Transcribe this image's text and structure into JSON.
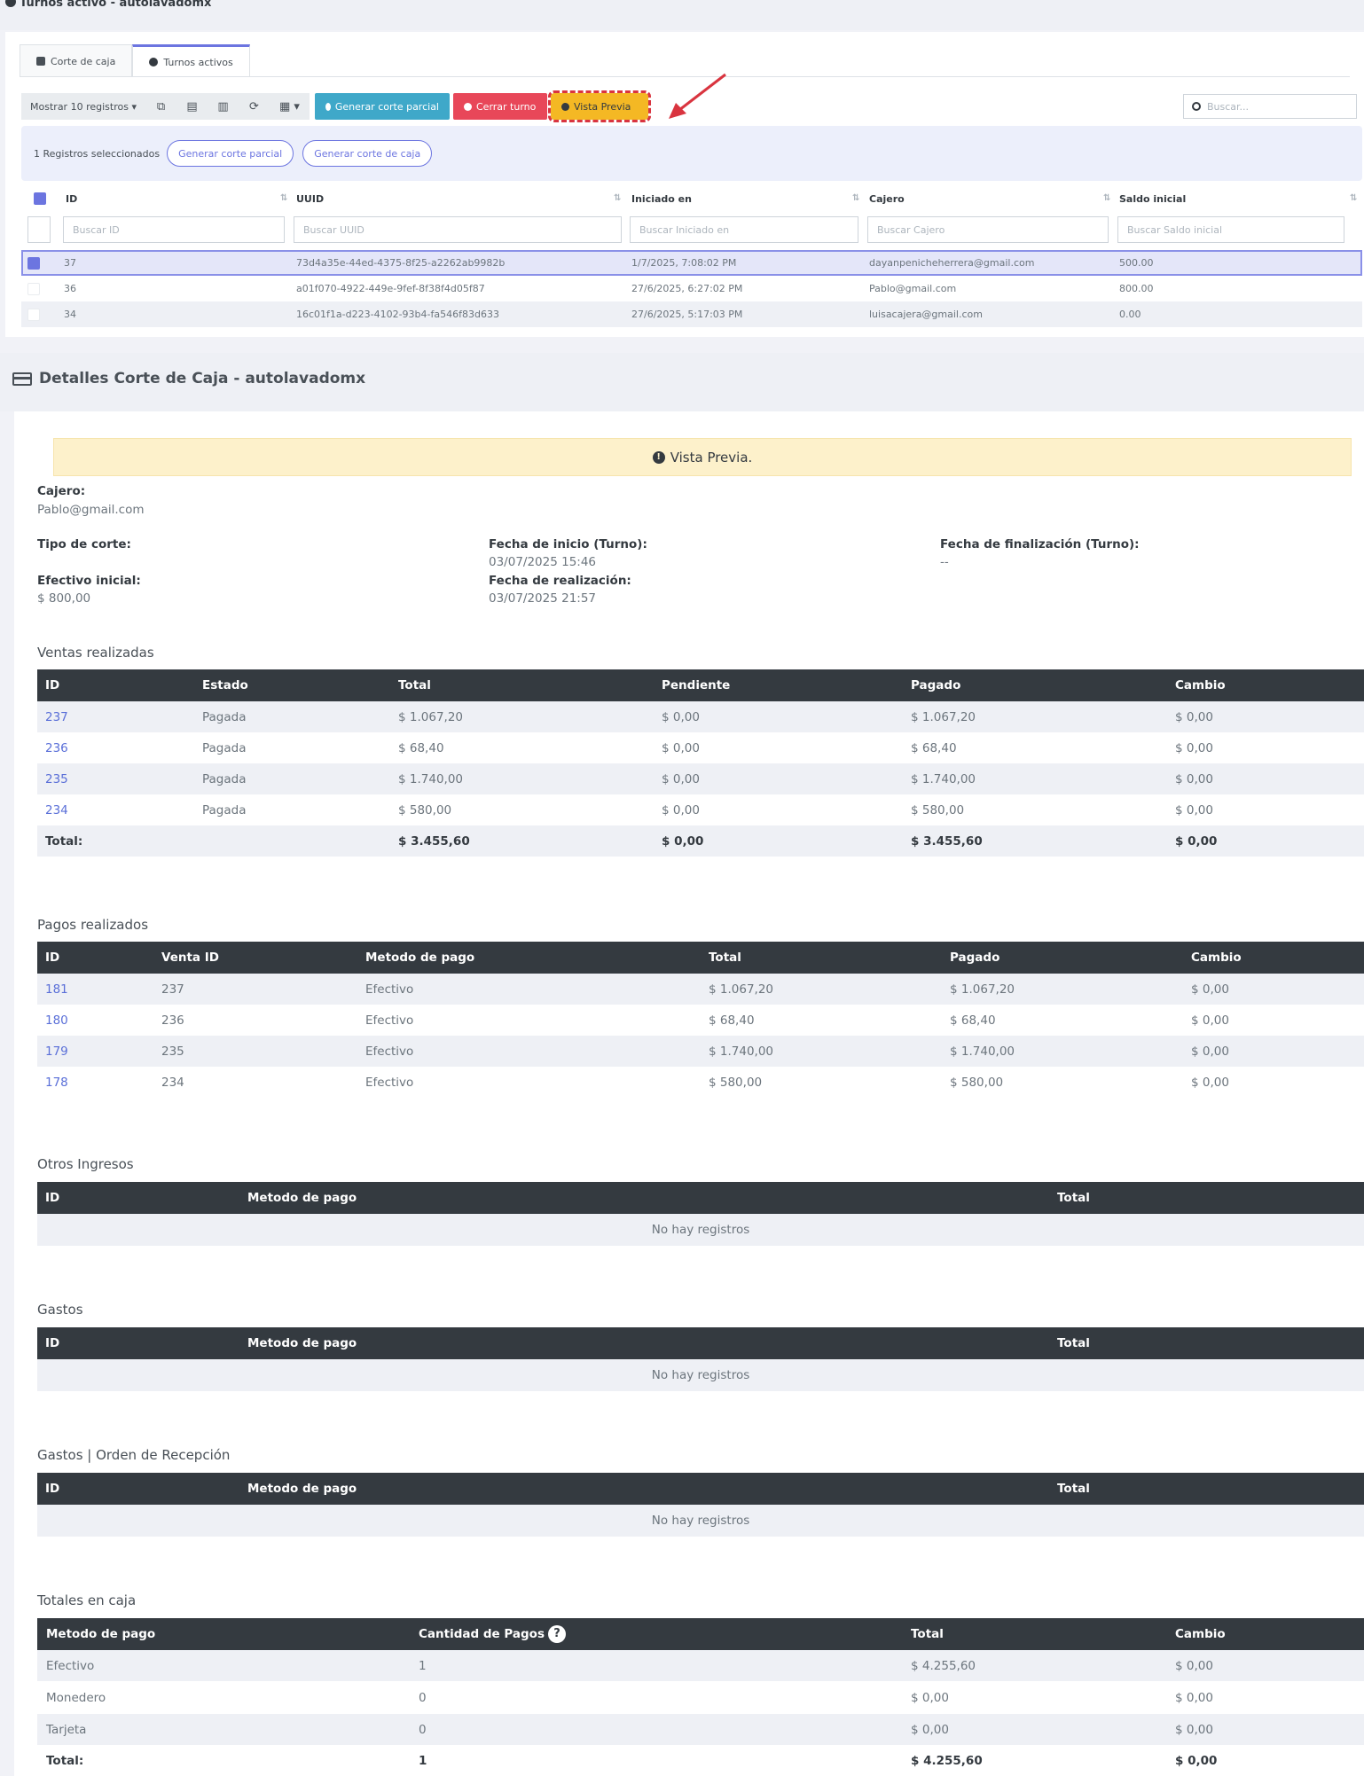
{
  "top": {
    "header_title": "Turnos activo - autolavadomx",
    "tabs": [
      {
        "label": "Corte de caja"
      },
      {
        "label": "Turnos activos"
      }
    ],
    "toolbar": {
      "show_records": "Mostrar 10 registros ▾",
      "btn_partial": "Generar corte parcial",
      "btn_close": "Cerrar turno",
      "btn_preview": "Vista Previa"
    },
    "search_placeholder": "Buscar...",
    "selection": {
      "text": "1 Registros seleccionados",
      "btn_partial": "Generar corte parcial",
      "btn_cut": "Generar corte de caja"
    },
    "columns": [
      "ID",
      "UUID",
      "Iniciado en",
      "Cajero",
      "Saldo inicial"
    ],
    "filters": [
      "Buscar ID",
      "Buscar UUID",
      "Buscar Iniciado en",
      "Buscar Cajero",
      "Buscar Saldo inicial"
    ],
    "rows": [
      {
        "id": "37",
        "uuid": "73d4a35e-44ed-4375-8f25-a2262ab9982b",
        "started": "1/7/2025, 7:08:02 PM",
        "cashier": "dayanpenicheherrera@gmail.com",
        "balance": "500.00"
      },
      {
        "id": "36",
        "uuid": "a01f070-4922-449e-9fef-8f38f4d05f87",
        "started": "27/6/2025, 6:27:02 PM",
        "cashier": "Pablo@gmail.com",
        "balance": "800.00"
      },
      {
        "id": "34",
        "uuid": "16c01f1a-d223-4102-93b4-fa546f83d633",
        "started": "27/6/2025, 5:17:03 PM",
        "cashier": "luisacajera@gmail.com",
        "balance": "0.00"
      }
    ]
  },
  "details": {
    "title": "Detalles Corte de Caja - autolavadomx",
    "alert": "Vista Previa.",
    "cajero_label": "Cajero:",
    "cajero_value": "Pablo@gmail.com",
    "tipo_label": "Tipo de corte:",
    "inicio_label": "Fecha de inicio (Turno):",
    "inicio_value": "03/07/2025 15:46",
    "fin_label": "Fecha de finalización (Turno):",
    "fin_value": "--",
    "efectivo_label": "Efectivo inicial:",
    "efectivo_value": "$ 800,00",
    "realizacion_label": "Fecha de realización:",
    "realizacion_value": "03/07/2025 21:57"
  },
  "ventas": {
    "title": "Ventas realizadas",
    "columns": [
      "ID",
      "Estado",
      "Total",
      "Pendiente",
      "Pagado",
      "Cambio"
    ],
    "rows": [
      [
        "237",
        "Pagada",
        "$ 1.067,20",
        "$ 0,00",
        "$ 1.067,20",
        "$ 0,00"
      ],
      [
        "236",
        "Pagada",
        "$ 68,40",
        "$ 0,00",
        "$ 68,40",
        "$ 0,00"
      ],
      [
        "235",
        "Pagada",
        "$ 1.740,00",
        "$ 0,00",
        "$ 1.740,00",
        "$ 0,00"
      ],
      [
        "234",
        "Pagada",
        "$ 580,00",
        "$ 0,00",
        "$ 580,00",
        "$ 0,00"
      ]
    ],
    "total": [
      "Total:",
      "",
      "$ 3.455,60",
      "$ 0,00",
      "$ 3.455,60",
      "$ 0,00"
    ]
  },
  "pagos": {
    "title": "Pagos realizados",
    "columns": [
      "ID",
      "Venta ID",
      "Metodo de pago",
      "Total",
      "Pagado",
      "Cambio"
    ],
    "rows": [
      [
        "181",
        "237",
        "Efectivo",
        "$ 1.067,20",
        "$ 1.067,20",
        "$ 0,00"
      ],
      [
        "180",
        "236",
        "Efectivo",
        "$ 68,40",
        "$ 68,40",
        "$ 0,00"
      ],
      [
        "179",
        "235",
        "Efectivo",
        "$ 1.740,00",
        "$ 1.740,00",
        "$ 0,00"
      ],
      [
        "178",
        "234",
        "Efectivo",
        "$ 580,00",
        "$ 580,00",
        "$ 0,00"
      ]
    ]
  },
  "otros": {
    "title": "Otros Ingresos",
    "columns": [
      "ID",
      "Metodo de pago",
      "Total"
    ],
    "empty": "No hay registros"
  },
  "gastos": {
    "title": "Gastos",
    "columns": [
      "ID",
      "Metodo de pago",
      "Total"
    ],
    "empty": "No hay registros"
  },
  "gastos_orden": {
    "title": "Gastos | Orden de Recepción",
    "columns": [
      "ID",
      "Metodo de pago",
      "Total"
    ],
    "empty": "No hay registros"
  },
  "totales": {
    "title": "Totales en caja",
    "columns": [
      "Metodo de pago",
      "Cantidad de Pagos",
      "Total",
      "Cambio"
    ],
    "rows": [
      [
        "Efectivo",
        "1",
        "$ 4.255,60",
        "$ 0,00"
      ],
      [
        "Monedero",
        "0",
        "$ 0,00",
        "$ 0,00"
      ],
      [
        "Tarjeta",
        "0",
        "$ 0,00",
        "$ 0,00"
      ]
    ],
    "total": [
      "Total:",
      "1",
      "$ 4.255,60",
      "$ 0,00"
    ]
  },
  "colors": {
    "accent": "#6c75e0",
    "table_header": "#343a40",
    "info": "#3fa8c9",
    "danger": "#e84759",
    "warning": "#f4b824",
    "alert_bg": "#fdf1cb"
  }
}
